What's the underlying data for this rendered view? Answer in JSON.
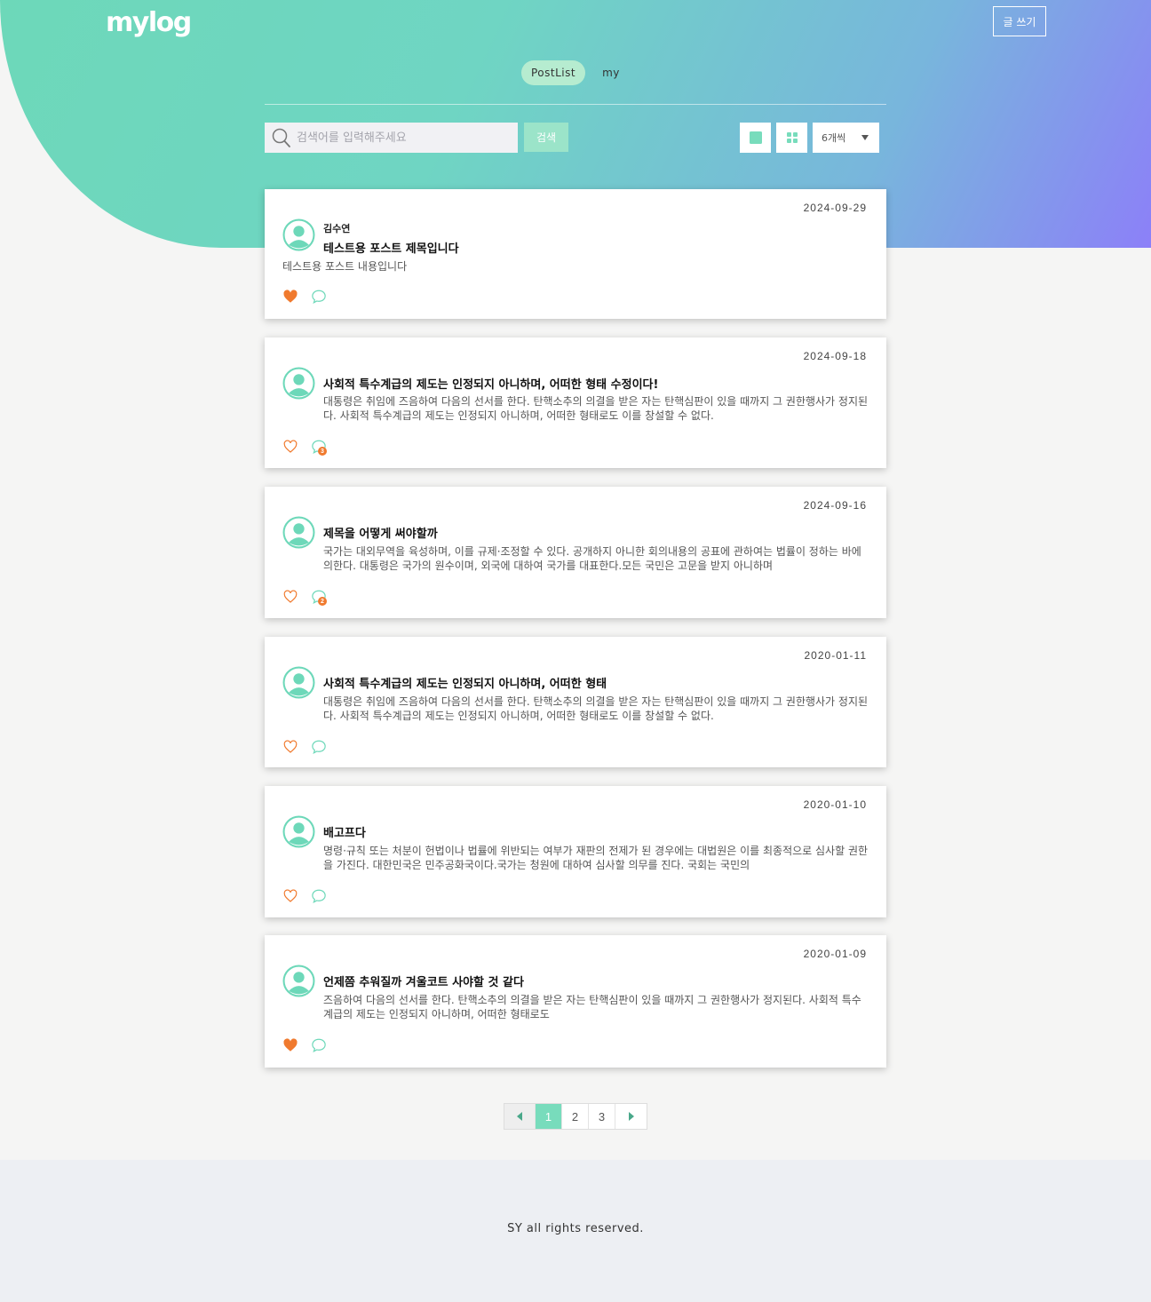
{
  "header": {
    "logo": "mylog",
    "write_label": "글 쓰기",
    "tabs": [
      {
        "label": "PostList",
        "active": true
      },
      {
        "label": "my",
        "active": false
      }
    ]
  },
  "toolbar": {
    "search_placeholder": "검색어를 입력해주세요",
    "search_label": "검색",
    "per_page": "6개씩"
  },
  "posts": [
    {
      "date": "2024-09-29",
      "author": "김수연",
      "title": "테스트용 포스트 제목입니다",
      "content": "테스트용 포스트 내용입니다",
      "liked": true,
      "comment_count": ""
    },
    {
      "date": "2024-09-18",
      "author": "",
      "title": "사회적 특수계급의 제도는 인정되지 아니하며, 어떠한 형태 수정이다!",
      "content": "대통령은 취임에 즈음하여 다음의 선서를 한다. 탄핵소추의 의결을 받은 자는 탄핵심판이 있을 때까지 그 권한행사가 정지된다. 사회적 특수계급의 제도는 인정되지 아니하며, 어떠한 형태로도 이를 창설할 수 없다.",
      "liked": false,
      "comment_count": "3"
    },
    {
      "date": "2024-09-16",
      "author": "",
      "title": "제목을 어떻게 써야할까",
      "content": "국가는 대외무역을 육성하며, 이를 규제·조정할 수 있다. 공개하지 아니한 회의내용의 공표에 관하여는 법률이 정하는 바에 의한다. 대통령은 국가의 원수이며, 외국에 대하여 국가를 대표한다.모든 국민은 고문을 받지 아니하며",
      "liked": false,
      "comment_count": "2"
    },
    {
      "date": "2020-01-11",
      "author": "",
      "title": "사회적 특수계급의 제도는 인정되지 아니하며, 어떠한 형태",
      "content": "대통령은 취임에 즈음하여 다음의 선서를 한다. 탄핵소추의 의결을 받은 자는 탄핵심판이 있을 때까지 그 권한행사가 정지된다. 사회적 특수계급의 제도는 인정되지 아니하며, 어떠한 형태로도 이를 창설할 수 없다.",
      "liked": false,
      "comment_count": ""
    },
    {
      "date": "2020-01-10",
      "author": "",
      "title": "배고프다",
      "content": "명령·규칙 또는 처분이 헌법이나 법률에 위반되는 여부가 재판의 전제가 된 경우에는 대법원은 이를 최종적으로 심사할 권한을 가진다. 대한민국은 민주공화국이다.국가는 청원에 대하여 심사할 의무를 진다. 국회는 국민의",
      "liked": false,
      "comment_count": ""
    },
    {
      "date": "2020-01-09",
      "author": "",
      "title": "언제쯤 추워질까 겨울코트 사야할 것 같다",
      "content": "즈음하여 다음의 선서를 한다. 탄핵소추의 의결을 받은 자는 탄핵심판이 있을 때까지 그 권한행사가 정지된다. 사회적 특수계급의 제도는 인정되지 아니하며, 어떠한 형태로도",
      "liked": true,
      "comment_count": ""
    }
  ],
  "pagination": {
    "pages": [
      "1",
      "2",
      "3"
    ],
    "current": "1"
  },
  "footer": {
    "text": "SY all rights reserved."
  },
  "colors": {
    "accent": "#78dcbc",
    "heart": "#f07a2e",
    "avatar": "#6dd8b9"
  }
}
